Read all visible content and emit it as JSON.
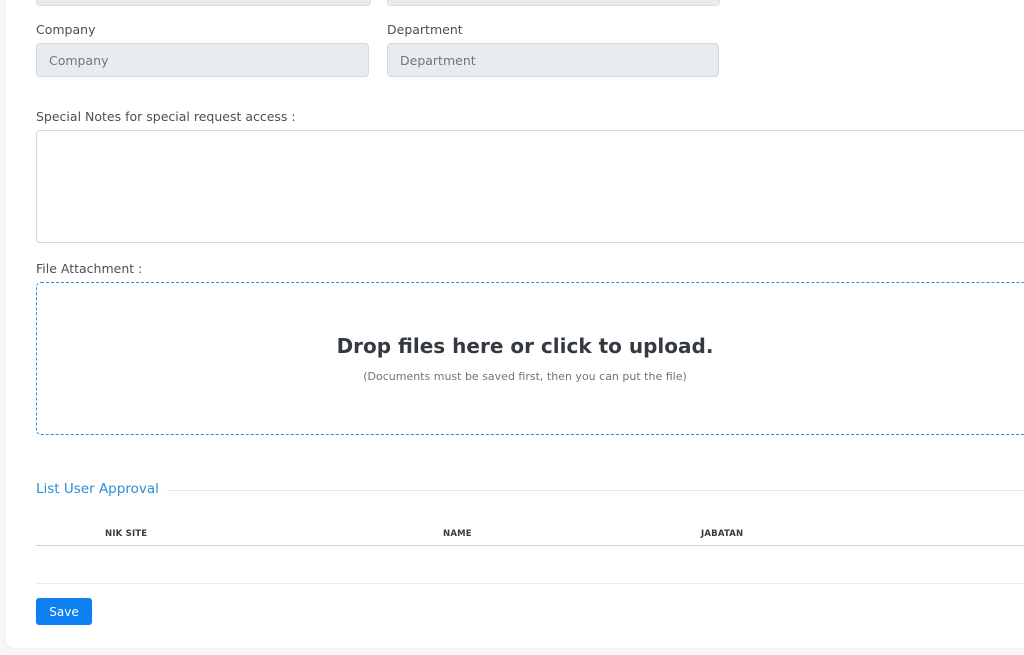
{
  "form": {
    "company": {
      "label": "Company",
      "placeholder": "Company"
    },
    "department": {
      "label": "Department",
      "placeholder": "Department"
    },
    "special_notes": {
      "label": "Special Notes for special request access :",
      "value": ""
    },
    "file_attachment": {
      "label": "File Attachment :",
      "dropzone_title": "Drop files here or click to upload.",
      "dropzone_subtitle": "(Documents must be saved first, then you can put the file)"
    }
  },
  "approval": {
    "title": "List User Approval",
    "columns": [
      "NIK SITE",
      "NAME",
      "JABATAN"
    ],
    "rows": []
  },
  "actions": {
    "save_label": "Save"
  },
  "colors": {
    "accent": "#0d7ff0",
    "section": "#2a8fd1",
    "input_bg": "#e9ecef"
  }
}
